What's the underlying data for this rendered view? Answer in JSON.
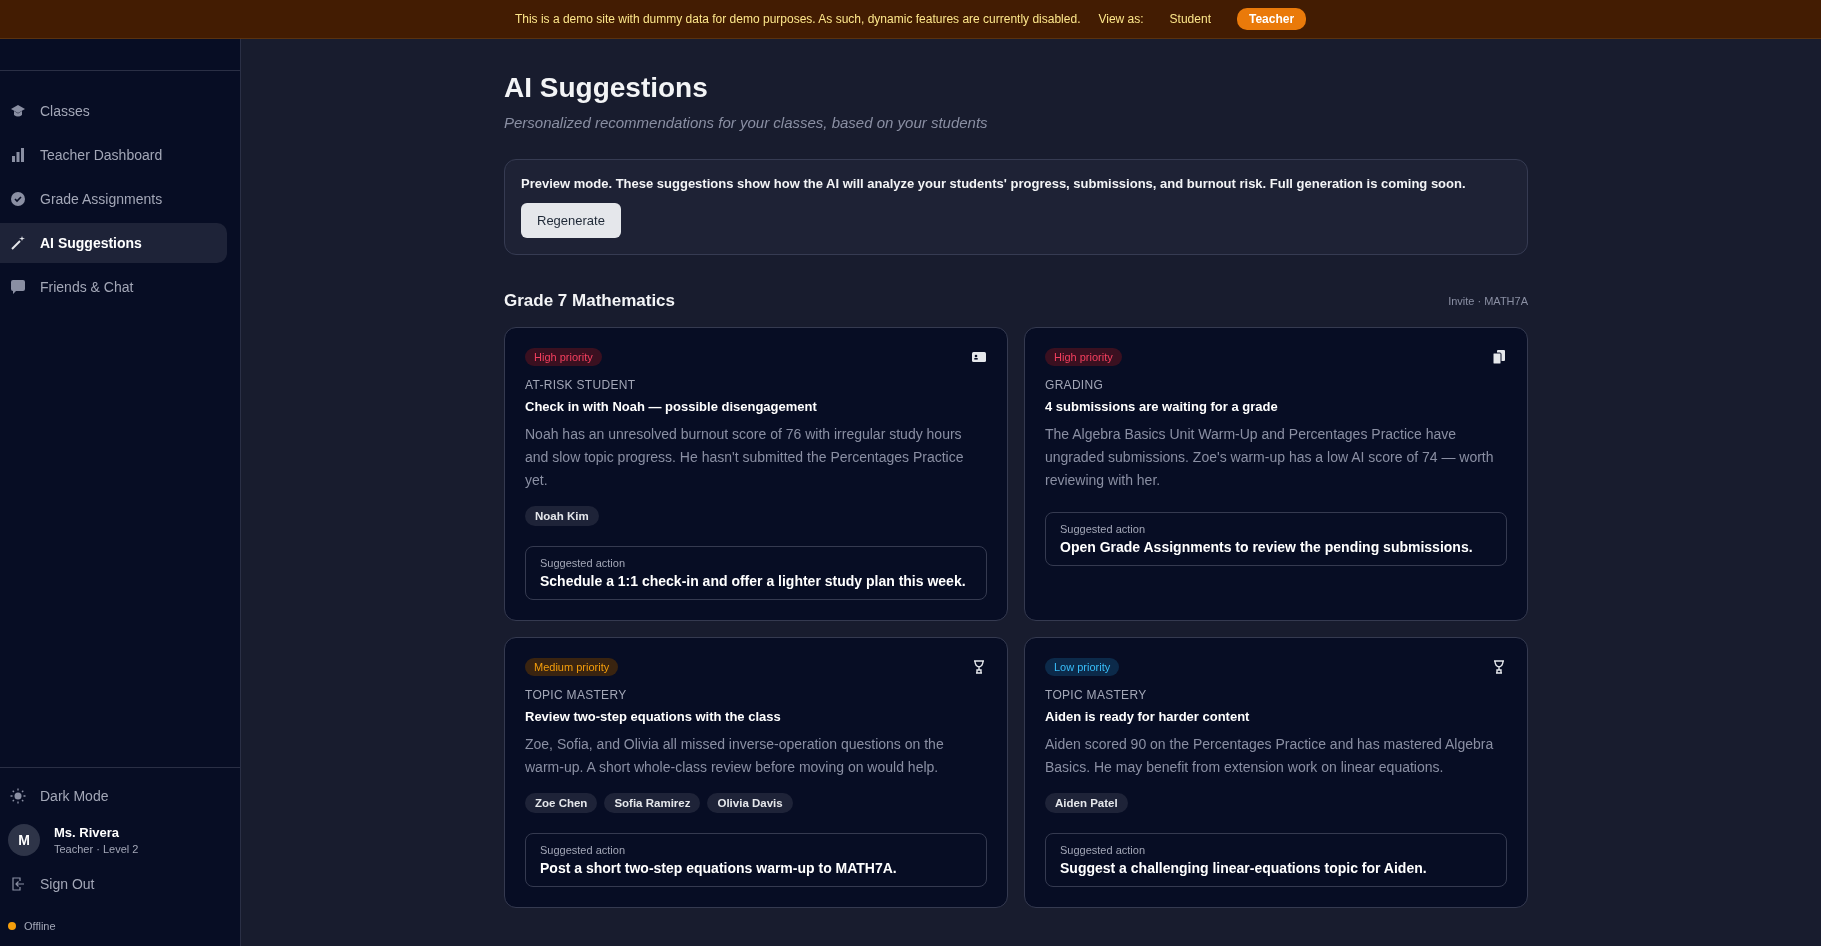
{
  "banner": {
    "message": "This is a demo site with dummy data for demo purposes. As such, dynamic features are currently disabled.",
    "view_as_label": "View as:",
    "view_options": [
      {
        "label": "Student",
        "selected": false
      },
      {
        "label": "Teacher",
        "selected": true
      }
    ]
  },
  "sidebar": {
    "items": [
      {
        "label": "Classes",
        "kind": "classes",
        "selected": false
      },
      {
        "label": "Teacher Dashboard",
        "kind": "dashboard",
        "selected": false
      },
      {
        "label": "Grade Assignments",
        "kind": "grade",
        "selected": false
      },
      {
        "label": "AI Suggestions",
        "kind": "ai",
        "selected": true
      },
      {
        "label": "Friends & Chat",
        "kind": "chat",
        "selected": false
      }
    ],
    "theme_toggle": "Dark Mode",
    "user": {
      "initial": "M",
      "name": "Ms. Rivera",
      "role": "Teacher · Level 2"
    },
    "sign_out": "Sign Out",
    "status": {
      "label": "Offline",
      "color": "#f59e0b"
    }
  },
  "page": {
    "title": "AI Suggestions",
    "subtitle": "Personalized recommendations for your classes, based on your students",
    "notice": {
      "text": "Preview mode. These suggestions show how the AI will analyze your students' progress, submissions, and burnout risk. Full generation is coming soon.",
      "button": "Regenerate"
    },
    "class_section": {
      "title": "Grade 7 Mathematics",
      "invite": "Invite · MATH7A",
      "cards": [
        {
          "priority": {
            "label": "High priority",
            "kind": "high"
          },
          "kind": "at-risk",
          "category": "AT-RISK STUDENT",
          "title": "Check in with Noah — possible disengagement",
          "body": "Noah has an unresolved burnout score of 76 with irregular study hours and slow topic progress. He hasn't submitted the Percentages Practice yet.",
          "students": [
            "Noah Kim"
          ],
          "action_label": "Suggested action",
          "action": "Schedule a 1:1 check-in and offer a lighter study plan this week."
        },
        {
          "priority": {
            "label": "High priority",
            "kind": "high"
          },
          "kind": "grading",
          "category": "GRADING",
          "title": "4 submissions are waiting for a grade",
          "body": "The Algebra Basics Unit Warm-Up and Percentages Practice have ungraded submissions. Zoe's warm-up has a low AI score of 74 — worth reviewing with her.",
          "action_label": "Suggested action",
          "action": "Open Grade Assignments to review the pending submissions."
        },
        {
          "priority": {
            "label": "Medium priority",
            "kind": "medium"
          },
          "kind": "mastery",
          "category": "TOPIC MASTERY",
          "title": "Review two-step equations with the class",
          "body": "Zoe, Sofia, and Olivia all missed inverse-operation questions on the warm-up. A short whole-class review before moving on would help.",
          "students": [
            "Zoe Chen",
            "Sofia Ramirez",
            "Olivia Davis"
          ],
          "action_label": "Suggested action",
          "action": "Post a short two-step equations warm-up to MATH7A."
        },
        {
          "priority": {
            "label": "Low priority",
            "kind": "low"
          },
          "kind": "mastery",
          "category": "TOPIC MASTERY",
          "title": "Aiden is ready for harder content",
          "body": "Aiden scored 90 on the Percentages Practice and has mastered Algebra Basics. He may benefit from extension work on linear equations.",
          "students": [
            "Aiden Patel"
          ],
          "action_label": "Suggested action",
          "action": "Suggest a challenging linear-equations topic for Aiden."
        }
      ]
    }
  }
}
